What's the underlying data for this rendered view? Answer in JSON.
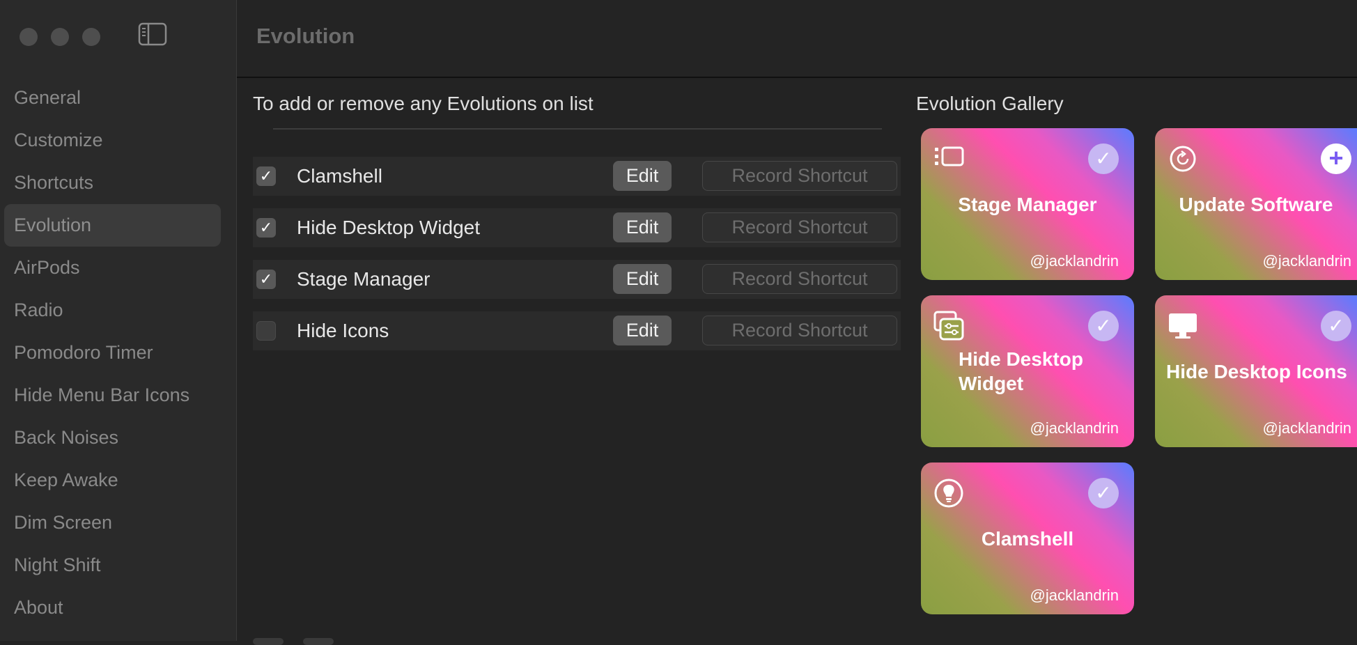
{
  "window": {
    "title": "Evolution"
  },
  "sidebar": {
    "items": [
      {
        "label": "General"
      },
      {
        "label": "Customize"
      },
      {
        "label": "Shortcuts"
      },
      {
        "label": "Evolution"
      },
      {
        "label": "AirPods"
      },
      {
        "label": "Radio"
      },
      {
        "label": "Pomodoro Timer"
      },
      {
        "label": "Hide Menu Bar Icons"
      },
      {
        "label": "Back Noises"
      },
      {
        "label": "Keep Awake"
      },
      {
        "label": "Dim Screen"
      },
      {
        "label": "Night Shift"
      },
      {
        "label": "About"
      }
    ],
    "selected": "Evolution",
    "toggle_icon": "sidebar-icon"
  },
  "list": {
    "heading": "To add or remove any Evolutions on list",
    "rows": [
      {
        "label": "Clamshell",
        "checked": true,
        "edit_label": "Edit",
        "record_label": "Record Shortcut"
      },
      {
        "label": "Hide Desktop Widget",
        "checked": true,
        "edit_label": "Edit",
        "record_label": "Record Shortcut"
      },
      {
        "label": "Stage Manager",
        "checked": true,
        "edit_label": "Edit",
        "record_label": "Record Shortcut"
      },
      {
        "label": "Hide Icons",
        "checked": false,
        "edit_label": "Edit",
        "record_label": "Record Shortcut"
      }
    ],
    "check_glyph": "✓"
  },
  "gallery": {
    "heading": "Evolution Gallery",
    "cards": [
      {
        "title": "Stage Manager",
        "author": "@jacklandrin",
        "icon": "stage-manager-icon",
        "added": true
      },
      {
        "title": "Update Software",
        "author": "@jacklandrin",
        "icon": "refresh-icon",
        "added": false
      },
      {
        "title": "Hide Desktop Widget",
        "author": "@jacklandrin",
        "icon": "widgets-icon",
        "added": true
      },
      {
        "title": "Hide Desktop Icons",
        "author": "@jacklandrin",
        "icon": "display-icon",
        "added": true
      },
      {
        "title": "Clamshell",
        "author": "@jacklandrin",
        "icon": "lightbulb-icon",
        "added": true
      }
    ],
    "check_glyph": "✓",
    "plus_glyph": "+"
  },
  "colors": {
    "background": "#232323",
    "sidebar": "#2a2a2a",
    "accent_check": "#c7b7f3",
    "plus_accent": "#7a5cf2"
  }
}
